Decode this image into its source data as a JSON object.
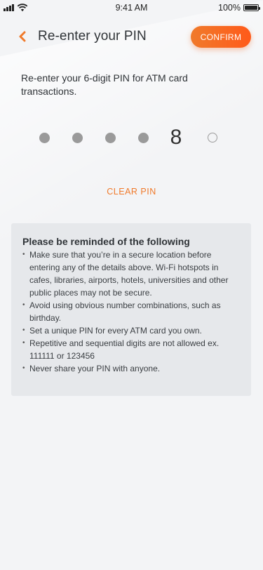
{
  "status_bar": {
    "time": "9:41 AM",
    "battery": "100%",
    "icons": [
      "signal-icon",
      "wifi-icon",
      "battery-icon"
    ]
  },
  "header": {
    "title": "Re-enter your PIN",
    "back_icon": "chevron-left-icon",
    "confirm_label": "CONFIRM"
  },
  "instructions": "Re-enter your 6-digit PIN for ATM card transactions.",
  "pin": {
    "length": 6,
    "entered_count": 5,
    "last_digit": "8"
  },
  "clear_pin_label": "CLEAR PIN",
  "reminder": {
    "title": "Please be reminded of the following",
    "items": [
      "Make sure that you’re in a  secure location before entering any of the details above. Wi-Fi hotspots in cafes, libraries, airports, hotels, universities and other public places may not be secure.",
      "Avoid using obvious number combinations, such as birthday.",
      "Set a unique PIN for every ATM card you own.",
      "Repetitive and sequential digits are not allowed ex. 111111 or 123456",
      "Never share your PIN with anyone."
    ]
  },
  "colors": {
    "accent": "#f07a2b",
    "background": "#f3f4f6",
    "card": "#e6e8eb",
    "dot": "#9a9a9a"
  }
}
